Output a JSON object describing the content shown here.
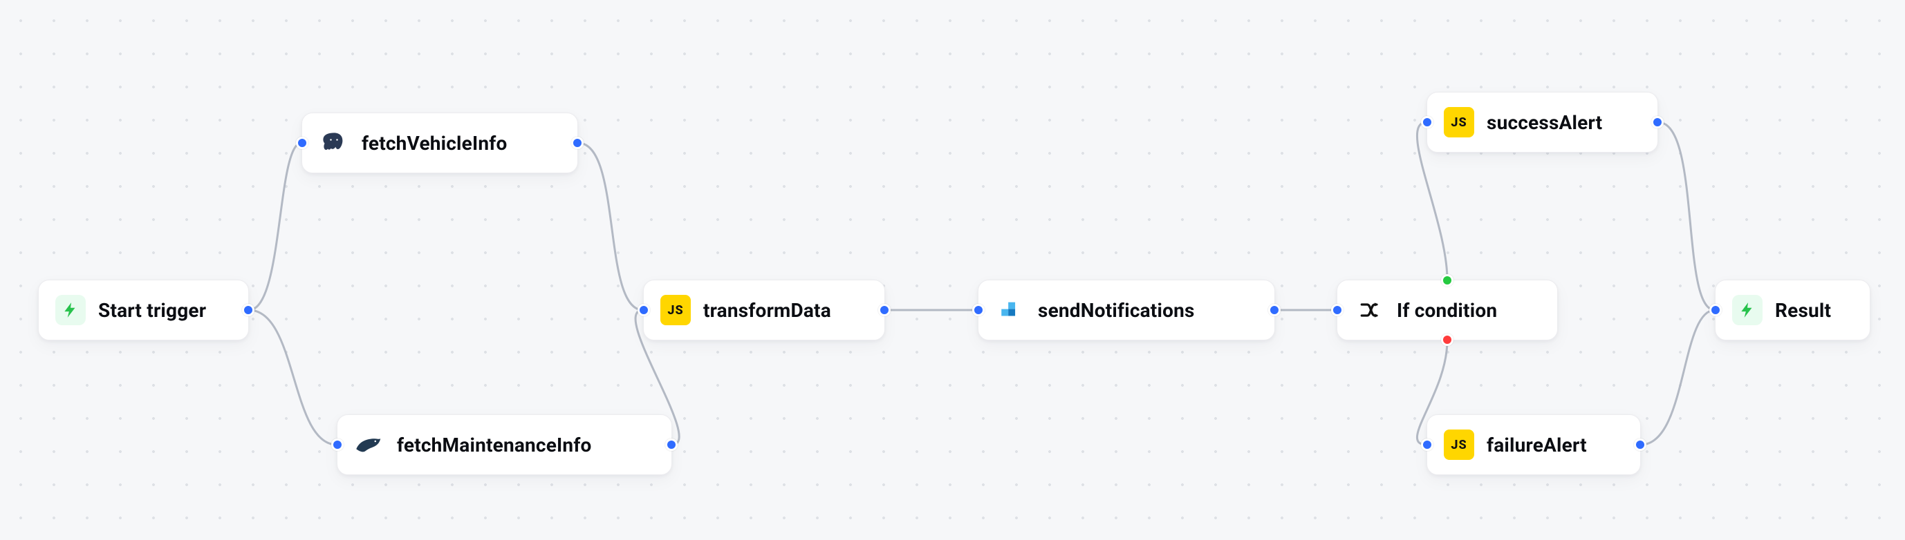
{
  "nodes": {
    "start": {
      "label": "Start trigger",
      "icon": "bolt"
    },
    "vehicle": {
      "label": "fetchVehicleInfo",
      "icon": "postgres"
    },
    "maint": {
      "label": "fetchMaintenanceInfo",
      "icon": "maria"
    },
    "trans": {
      "label": "transformData",
      "icon": "js"
    },
    "send": {
      "label": "sendNotifications",
      "icon": "send"
    },
    "cond": {
      "label": "If condition",
      "icon": "cond"
    },
    "succ": {
      "label": "successAlert",
      "icon": "js"
    },
    "fail": {
      "label": "failureAlert",
      "icon": "js"
    },
    "result": {
      "label": "Result",
      "icon": "bolt"
    }
  },
  "edges": [
    {
      "from": "start.right",
      "to": "vehicle.left"
    },
    {
      "from": "start.right",
      "to": "maint.left"
    },
    {
      "from": "vehicle.right",
      "to": "trans.left"
    },
    {
      "from": "maint.right",
      "to": "trans.left"
    },
    {
      "from": "trans.right",
      "to": "send.left"
    },
    {
      "from": "send.right",
      "to": "cond.left"
    },
    {
      "from": "cond.top",
      "to": "succ.left",
      "branch": "true"
    },
    {
      "from": "cond.bottom",
      "to": "fail.left",
      "branch": "false"
    },
    {
      "from": "succ.right",
      "to": "result.left"
    },
    {
      "from": "fail.right",
      "to": "result.left"
    }
  ],
  "colors": {
    "port_default": "#2f6bff",
    "port_true": "#25c940",
    "port_false": "#ff3b3b",
    "edge": "#b3b9c4",
    "bolt": "#27c24c"
  }
}
